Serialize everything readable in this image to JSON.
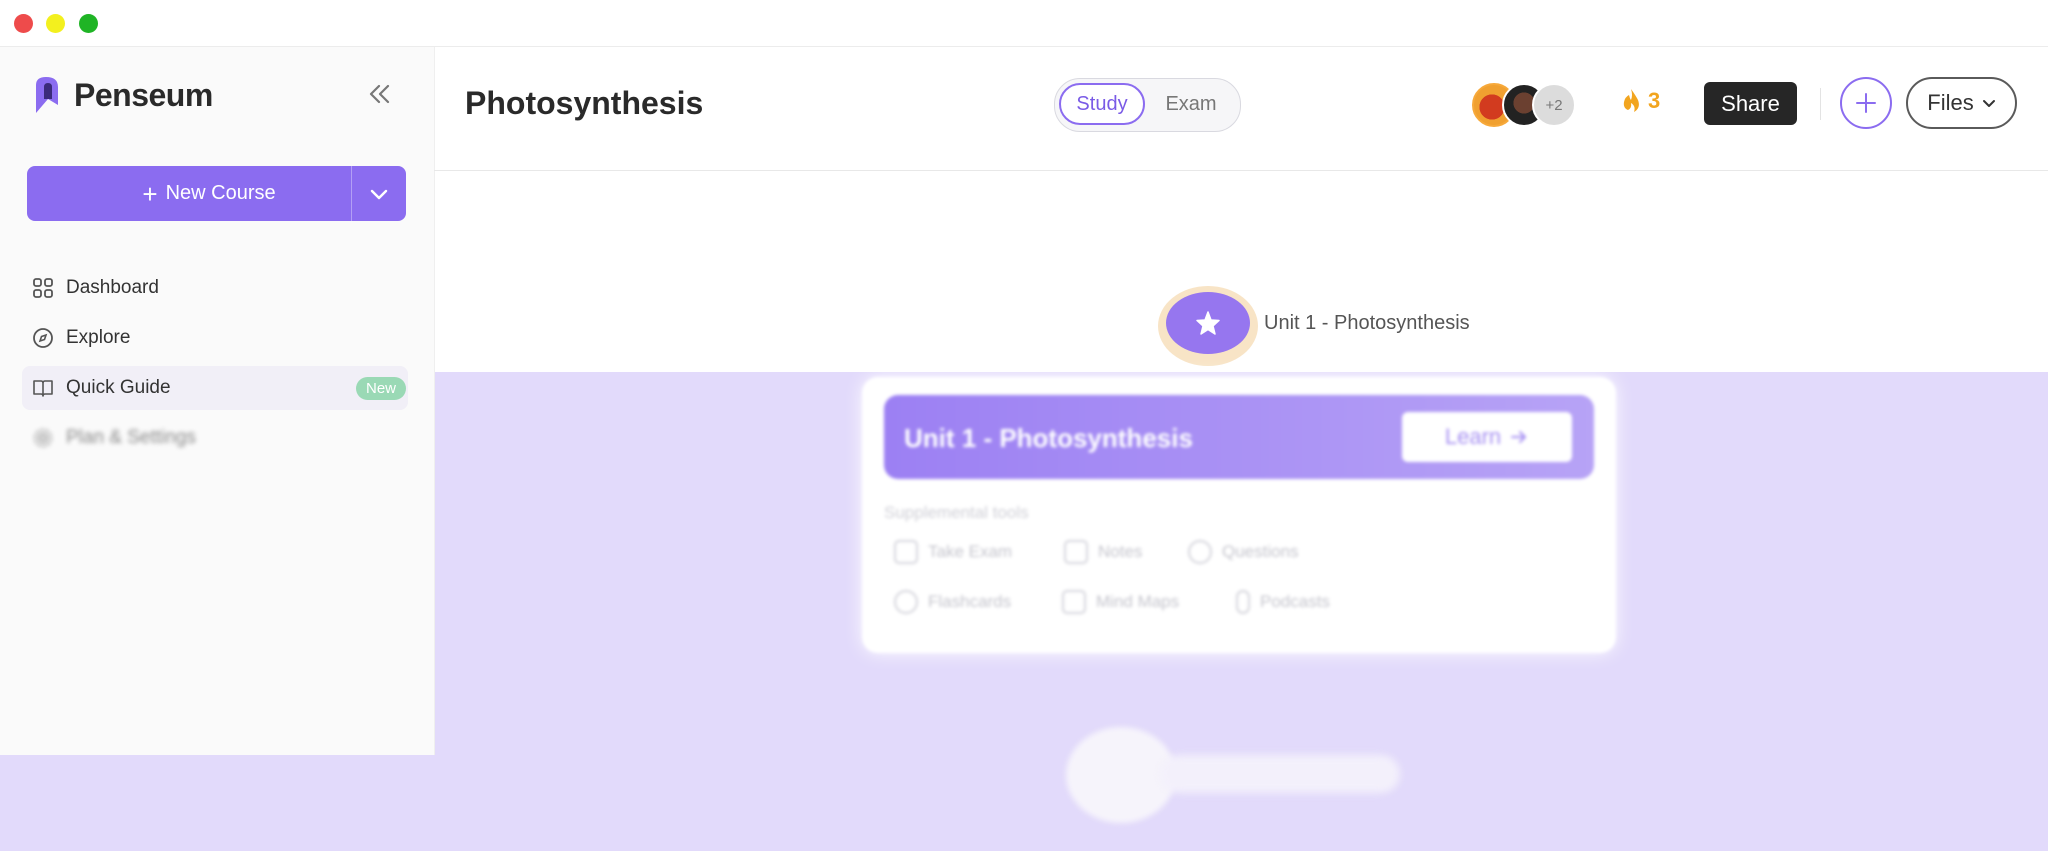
{
  "window": {
    "controls": [
      "close",
      "minimize",
      "maximize"
    ]
  },
  "sidebar": {
    "brand": "Penseum",
    "collapse_icon": "double-chevron-left-icon",
    "new_course": {
      "label": "New Course",
      "dropdown_icon": "chevron-down-icon"
    },
    "items": [
      {
        "label": "Dashboard",
        "icon": "grid-icon"
      },
      {
        "label": "Explore",
        "icon": "compass-icon"
      },
      {
        "label": "Quick Guide",
        "icon": "book-icon",
        "badge": "New"
      },
      {
        "label": "Plan & Settings",
        "icon": "gear-icon"
      }
    ]
  },
  "header": {
    "title": "Photosynthesis",
    "modes": {
      "study": "Study",
      "exam": "Exam",
      "selected": "Study"
    },
    "avatars_more": "+2",
    "streak_count": "3",
    "share_label": "Share",
    "files_label": "Files"
  },
  "course": {
    "unit_node_label": "Unit 1 - Photosynthesis",
    "card": {
      "title": "Unit 1 - Photosynthesis",
      "learn_label": "Learn",
      "supplemental_label": "Supplemental tools",
      "tools": [
        "Take Exam",
        "Notes",
        "Questions",
        "Flashcards",
        "Mind Maps",
        "Podcasts"
      ]
    }
  },
  "colors": {
    "accent": "#8b6cf0",
    "background_lower": "#e2dafb",
    "streak": "#f2a51f",
    "new_badge": "#9ad9b5"
  }
}
